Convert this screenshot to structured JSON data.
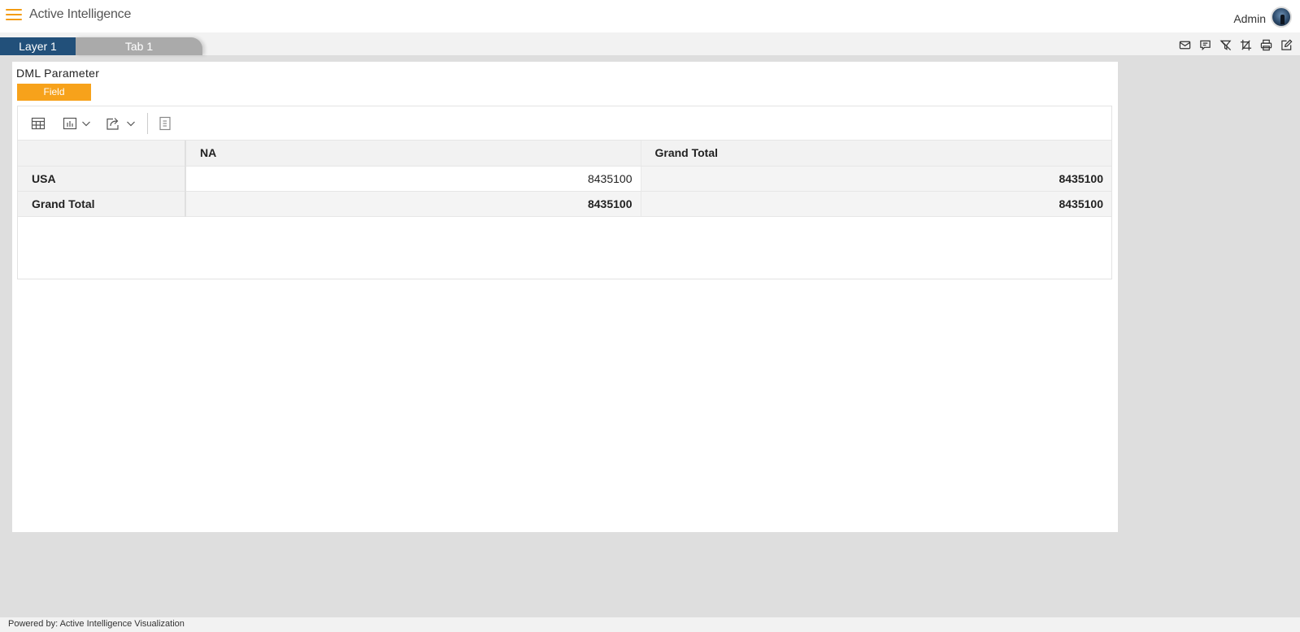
{
  "header": {
    "app_title": "Active Intelligence",
    "user_name": "Admin",
    "menu_icon": "hamburger-icon",
    "avatar_icon": "user-avatar"
  },
  "tabs": [
    {
      "label": "Layer 1",
      "active": true
    },
    {
      "label": "Tab 1",
      "active": false
    }
  ],
  "toolbar_icons": [
    "mail-icon",
    "comment-icon",
    "clear-filter-icon",
    "crop-icon",
    "print-icon",
    "edit-icon"
  ],
  "panel": {
    "title": "DML Parameter",
    "field_button": "Field",
    "grid_toolbar": [
      "table-icon",
      "chart-icon",
      "export-icon",
      "formula-icon"
    ]
  },
  "table": {
    "columns": [
      "",
      "NA",
      "Grand Total"
    ],
    "rows": [
      {
        "label": "USA",
        "values": [
          "8435100",
          "8435100"
        ]
      },
      {
        "label": "Grand Total",
        "values": [
          "8435100",
          "8435100"
        ]
      }
    ]
  },
  "colors": {
    "accent": "#f7a21b",
    "active_tab": "#22507a",
    "inactive_tab": "#aaaaaa"
  },
  "footer": {
    "text": "Powered by: Active Intelligence Visualization"
  }
}
